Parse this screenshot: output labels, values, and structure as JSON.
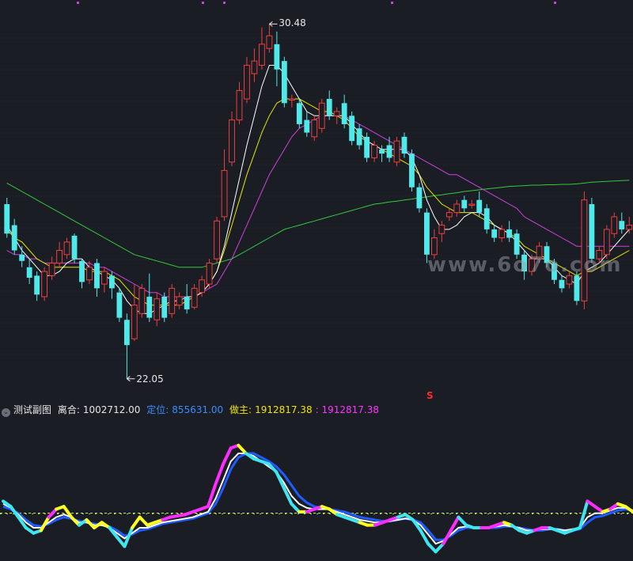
{
  "toolbar": {
    "toggle_glyph": "⌄",
    "sub_chart_name": "测试副图",
    "v1_label": "离合:",
    "v1_value": "1002712.00",
    "v2_label": "定位:",
    "v2_value": "855631.00",
    "v3_label": "做主:",
    "v3_value": "1912817.38",
    "v4_text": ": 1912817.38"
  },
  "price_labels": {
    "high": "30.48",
    "low": "22.05"
  },
  "markers": {
    "s_mark": "S"
  },
  "watermark": "www.6o7o.com",
  "colors": {
    "background": "#1b1d25",
    "up": "#ef3e3e",
    "down": "#4fe9ea",
    "ma_white": "#ffffff",
    "ma_yellow": "#e6e600",
    "ma_magenta": "#d23fe0",
    "ma_green": "#34c83c",
    "kline_main": "#ffff22",
    "kline_alt": "#ff2cff",
    "kline_cyan": "#3ee6f0",
    "osc_white": "#ffffff",
    "osc_blue": "#1f5cff"
  },
  "chart_data": {
    "type": "candlestick",
    "ylim": [
      21.8,
      30.9
    ],
    "high_label": 30.48,
    "low_label": 22.05,
    "candles": [
      [
        26.2,
        25.5,
        26.35,
        25.4
      ],
      [
        25.7,
        25.1,
        25.85,
        25.0
      ],
      [
        25.0,
        24.85,
        25.2,
        24.7
      ],
      [
        24.7,
        24.45,
        24.9,
        24.3
      ],
      [
        24.5,
        24.05,
        24.6,
        23.9
      ],
      [
        24.0,
        24.6,
        24.7,
        23.9
      ],
      [
        24.5,
        24.8,
        24.95,
        24.4
      ],
      [
        24.8,
        25.1,
        25.3,
        24.7
      ],
      [
        25.0,
        25.3,
        25.4,
        24.9
      ],
      [
        25.45,
        24.9,
        25.5,
        24.8
      ],
      [
        24.85,
        24.35,
        24.9,
        24.2
      ],
      [
        24.4,
        24.7,
        24.85,
        24.3
      ],
      [
        24.8,
        24.2,
        24.9,
        24.0
      ],
      [
        24.3,
        24.6,
        24.7,
        24.1
      ],
      [
        24.5,
        24.2,
        24.6,
        23.95
      ],
      [
        24.1,
        23.5,
        24.2,
        23.4
      ],
      [
        23.45,
        22.85,
        23.6,
        22.05
      ],
      [
        23.0,
        23.8,
        24.3,
        22.95
      ],
      [
        23.6,
        24.2,
        24.3,
        23.5
      ],
      [
        24.0,
        23.5,
        24.55,
        23.4
      ],
      [
        23.45,
        23.95,
        24.1,
        23.3
      ],
      [
        24.0,
        23.5,
        24.1,
        23.4
      ],
      [
        23.6,
        24.2,
        24.3,
        23.5
      ],
      [
        23.8,
        24.0,
        24.1,
        23.7
      ],
      [
        24.0,
        23.7,
        24.3,
        23.6
      ],
      [
        23.75,
        24.2,
        24.3,
        23.7
      ],
      [
        24.1,
        24.4,
        24.5,
        24.0
      ],
      [
        24.3,
        24.8,
        24.9,
        24.2
      ],
      [
        24.9,
        25.8,
        25.9,
        24.8
      ],
      [
        25.9,
        27.0,
        27.5,
        25.8
      ],
      [
        27.2,
        28.2,
        28.4,
        27.1
      ],
      [
        28.2,
        28.9,
        29.1,
        28.1
      ],
      [
        28.7,
        29.5,
        29.7,
        28.6
      ],
      [
        29.3,
        29.6,
        29.9,
        29.1
      ],
      [
        29.5,
        30.0,
        30.4,
        29.4
      ],
      [
        29.9,
        30.2,
        30.48,
        29.8
      ],
      [
        30.0,
        29.4,
        30.3,
        29.0
      ],
      [
        29.6,
        28.6,
        29.7,
        28.5
      ],
      [
        28.7,
        28.7,
        28.8,
        28.5
      ],
      [
        28.6,
        28.1,
        28.7,
        28.0
      ],
      [
        28.2,
        27.9,
        28.4,
        27.8
      ],
      [
        27.8,
        28.2,
        28.3,
        27.7
      ],
      [
        28.0,
        28.6,
        28.7,
        27.9
      ],
      [
        28.7,
        28.3,
        28.9,
        28.2
      ],
      [
        28.3,
        28.4,
        28.5,
        28.1
      ],
      [
        28.6,
        28.1,
        28.8,
        28.0
      ],
      [
        28.3,
        27.7,
        28.4,
        27.6
      ],
      [
        28.0,
        27.6,
        28.1,
        27.5
      ],
      [
        27.8,
        27.3,
        27.9,
        27.2
      ],
      [
        27.3,
        27.6,
        27.7,
        27.2
      ],
      [
        27.5,
        27.4,
        27.6,
        27.2
      ],
      [
        27.6,
        27.3,
        27.8,
        27.2
      ],
      [
        27.2,
        27.7,
        27.8,
        27.1
      ],
      [
        27.8,
        27.4,
        27.9,
        27.3
      ],
      [
        27.4,
        26.6,
        27.5,
        26.5
      ],
      [
        26.6,
        26.1,
        26.7,
        26.0
      ],
      [
        26.0,
        25.0,
        26.1,
        24.8
      ],
      [
        25.0,
        25.4,
        25.6,
        24.9
      ],
      [
        25.5,
        25.7,
        25.8,
        25.3
      ],
      [
        25.9,
        26.0,
        26.1,
        25.8
      ],
      [
        26.0,
        26.2,
        26.3,
        25.9
      ],
      [
        26.3,
        26.1,
        26.4,
        26.0
      ],
      [
        26.2,
        26.2,
        26.3,
        26.1
      ],
      [
        26.3,
        26.0,
        26.5,
        25.9
      ],
      [
        26.1,
        25.6,
        26.2,
        25.5
      ],
      [
        25.6,
        25.4,
        25.7,
        25.3
      ],
      [
        25.4,
        25.6,
        25.7,
        25.3
      ],
      [
        25.6,
        25.4,
        25.8,
        25.3
      ],
      [
        25.5,
        25.0,
        25.6,
        24.9
      ],
      [
        25.0,
        24.6,
        25.1,
        24.4
      ],
      [
        24.6,
        24.9,
        25.0,
        24.5
      ],
      [
        24.9,
        25.2,
        25.3,
        24.8
      ],
      [
        25.2,
        24.8,
        25.3,
        24.7
      ],
      [
        24.8,
        24.4,
        24.9,
        24.3
      ],
      [
        24.4,
        24.2,
        24.5,
        24.1
      ],
      [
        24.3,
        24.5,
        24.6,
        24.2
      ],
      [
        24.5,
        23.9,
        24.6,
        23.8
      ],
      [
        23.9,
        26.3,
        26.5,
        23.7
      ],
      [
        26.2,
        24.9,
        26.35,
        24.8
      ],
      [
        24.9,
        25.1,
        25.2,
        24.8
      ],
      [
        25.0,
        25.6,
        25.7,
        24.9
      ],
      [
        25.5,
        25.9,
        26.0,
        25.4
      ],
      [
        25.8,
        25.6,
        26.0,
        25.5
      ],
      [
        25.6,
        25.7,
        25.9,
        25.5
      ]
    ],
    "ma_white": [
      25.7,
      25.4,
      25.1,
      24.9,
      24.7,
      24.5,
      24.5,
      24.6,
      24.8,
      24.9,
      24.9,
      24.7,
      24.6,
      24.5,
      24.4,
      24.2,
      23.9,
      23.7,
      23.6,
      23.6,
      23.7,
      23.8,
      23.9,
      23.9,
      24.0,
      24.0,
      24.1,
      24.3,
      24.6,
      25.2,
      26.0,
      26.8,
      27.6,
      28.3,
      29.0,
      29.5,
      29.5,
      29.3,
      29.0,
      28.7,
      28.4,
      28.3,
      28.3,
      28.3,
      28.3,
      28.3,
      28.1,
      27.9,
      27.7,
      27.6,
      27.5,
      27.5,
      27.5,
      27.5,
      27.3,
      26.9,
      26.3,
      25.9,
      25.6,
      25.6,
      25.7,
      25.9,
      26.0,
      26.0,
      25.9,
      25.7,
      25.6,
      25.5,
      25.3,
      25.1,
      24.9,
      24.9,
      24.9,
      24.7,
      24.5,
      24.4,
      24.3,
      24.6,
      24.7,
      24.8,
      25.0,
      25.2,
      25.4,
      25.6
    ],
    "ma_yellow": [
      25.6,
      25.4,
      25.3,
      25.1,
      24.9,
      24.8,
      24.7,
      24.7,
      24.7,
      24.7,
      24.7,
      24.6,
      24.6,
      24.6,
      24.5,
      24.4,
      24.2,
      24.0,
      23.9,
      23.8,
      23.8,
      23.8,
      23.8,
      23.8,
      23.9,
      24.0,
      24.1,
      24.3,
      24.6,
      25.1,
      25.7,
      26.3,
      26.9,
      27.4,
      27.9,
      28.3,
      28.6,
      28.7,
      28.7,
      28.7,
      28.6,
      28.5,
      28.4,
      28.4,
      28.3,
      28.2,
      28.0,
      27.8,
      27.7,
      27.6,
      27.5,
      27.4,
      27.3,
      27.2,
      27.1,
      26.9,
      26.6,
      26.4,
      26.2,
      26.1,
      26.0,
      26.0,
      26.0,
      25.9,
      25.8,
      25.7,
      25.6,
      25.5,
      25.4,
      25.2,
      25.1,
      25.0,
      24.9,
      24.8,
      24.7,
      24.6,
      24.5,
      24.6,
      24.6,
      24.7,
      24.8,
      24.9,
      25.0,
      25.1
    ],
    "ma_magenta": [
      25.1,
      25.0,
      25.0,
      24.9,
      24.9,
      24.8,
      24.8,
      24.8,
      24.8,
      24.8,
      24.8,
      24.8,
      24.7,
      24.7,
      24.6,
      24.5,
      24.4,
      24.3,
      24.2,
      24.1,
      24.1,
      24.0,
      24.0,
      24.0,
      24.0,
      24.0,
      24.1,
      24.2,
      24.3,
      24.6,
      24.9,
      25.3,
      25.7,
      26.1,
      26.5,
      26.9,
      27.2,
      27.5,
      27.8,
      28.0,
      28.1,
      28.2,
      28.3,
      28.3,
      28.3,
      28.3,
      28.2,
      28.1,
      28.0,
      27.9,
      27.8,
      27.7,
      27.6,
      27.5,
      27.4,
      27.3,
      27.2,
      27.1,
      27.0,
      26.9,
      26.9,
      26.8,
      26.7,
      26.6,
      26.5,
      26.4,
      26.3,
      26.2,
      26.1,
      25.9,
      25.8,
      25.7,
      25.6,
      25.5,
      25.4,
      25.3,
      25.2,
      25.2,
      25.2,
      25.2,
      25.2,
      25.2,
      25.2,
      25.2
    ],
    "ma_green": [
      26.7,
      26.6,
      26.5,
      26.4,
      26.3,
      26.2,
      26.1,
      26.0,
      25.9,
      25.8,
      25.7,
      25.6,
      25.5,
      25.4,
      25.3,
      25.2,
      25.1,
      25.0,
      24.95,
      24.9,
      24.85,
      24.8,
      24.75,
      24.7,
      24.7,
      24.7,
      24.7,
      24.75,
      24.8,
      24.85,
      24.9,
      25.0,
      25.1,
      25.2,
      25.3,
      25.4,
      25.5,
      25.6,
      25.65,
      25.7,
      25.75,
      25.8,
      25.85,
      25.9,
      25.95,
      26.0,
      26.05,
      26.1,
      26.15,
      26.2,
      26.22,
      26.25,
      26.27,
      26.3,
      26.32,
      26.35,
      26.37,
      26.4,
      26.42,
      26.45,
      26.47,
      26.5,
      26.52,
      26.54,
      26.56,
      26.58,
      26.6,
      26.62,
      26.63,
      26.64,
      26.65,
      26.65,
      26.66,
      26.66,
      26.67,
      26.67,
      26.68,
      26.7,
      26.72,
      26.73,
      26.74,
      26.75,
      26.76,
      26.77
    ],
    "oscillator": {
      "ylim": [
        0,
        100
      ],
      "ref_level": 33,
      "main": [
        42,
        38,
        30,
        22,
        18,
        20,
        30,
        36,
        38,
        30,
        24,
        28,
        22,
        26,
        22,
        15,
        8,
        22,
        30,
        24,
        26,
        28,
        30,
        31,
        32,
        34,
        36,
        38,
        55,
        70,
        82,
        84,
        78,
        74,
        72,
        70,
        64,
        52,
        40,
        34,
        34,
        36,
        38,
        36,
        32,
        30,
        28,
        26,
        24,
        24,
        26,
        28,
        30,
        32,
        28,
        20,
        10,
        4,
        10,
        20,
        30,
        24,
        22,
        22,
        22,
        24,
        26,
        24,
        20,
        18,
        20,
        22,
        22,
        20,
        18,
        20,
        22,
        42,
        38,
        34,
        36,
        40,
        38,
        34
      ],
      "main_color_idx": [
        2,
        2,
        2,
        2,
        2,
        0,
        1,
        0,
        0,
        0,
        2,
        0,
        0,
        0,
        2,
        2,
        2,
        0,
        0,
        0,
        0,
        1,
        1,
        1,
        1,
        1,
        1,
        1,
        1,
        1,
        1,
        0,
        2,
        2,
        2,
        2,
        2,
        2,
        2,
        0,
        1,
        1,
        0,
        0,
        2,
        2,
        2,
        0,
        0,
        1,
        1,
        1,
        2,
        2,
        2,
        2,
        2,
        2,
        1,
        1,
        2,
        2,
        2,
        1,
        1,
        1,
        0,
        2,
        2,
        2,
        1,
        1,
        2,
        2,
        2,
        2,
        2,
        1,
        1,
        0,
        1,
        0,
        0,
        2
      ],
      "white": [
        40,
        37,
        32,
        26,
        22,
        22,
        26,
        30,
        32,
        30,
        26,
        26,
        24,
        24,
        22,
        18,
        14,
        18,
        22,
        22,
        24,
        26,
        27,
        28,
        29,
        30,
        32,
        34,
        44,
        58,
        72,
        78,
        78,
        76,
        72,
        68,
        64,
        56,
        46,
        40,
        37,
        36,
        36,
        36,
        34,
        32,
        30,
        28,
        27,
        26,
        26,
        27,
        28,
        29,
        28,
        24,
        17,
        10,
        12,
        17,
        22,
        23,
        22,
        22,
        22,
        23,
        24,
        23,
        22,
        20,
        20,
        21,
        21,
        21,
        20,
        21,
        22,
        30,
        33,
        33,
        35,
        37,
        37,
        35
      ],
      "blue": [
        38,
        36,
        33,
        28,
        24,
        23,
        25,
        28,
        30,
        29,
        27,
        26,
        25,
        24,
        23,
        20,
        16,
        17,
        20,
        21,
        23,
        25,
        26,
        27,
        28,
        29,
        31,
        33,
        40,
        52,
        66,
        75,
        78,
        78,
        75,
        72,
        68,
        62,
        54,
        46,
        41,
        38,
        37,
        36,
        35,
        34,
        32,
        30,
        29,
        28,
        27,
        27,
        28,
        29,
        28,
        26,
        20,
        13,
        13,
        16,
        20,
        22,
        22,
        22,
        22,
        22,
        23,
        23,
        22,
        21,
        20,
        20,
        21,
        21,
        20,
        20,
        21,
        26,
        30,
        31,
        33,
        35,
        36,
        35
      ]
    }
  }
}
